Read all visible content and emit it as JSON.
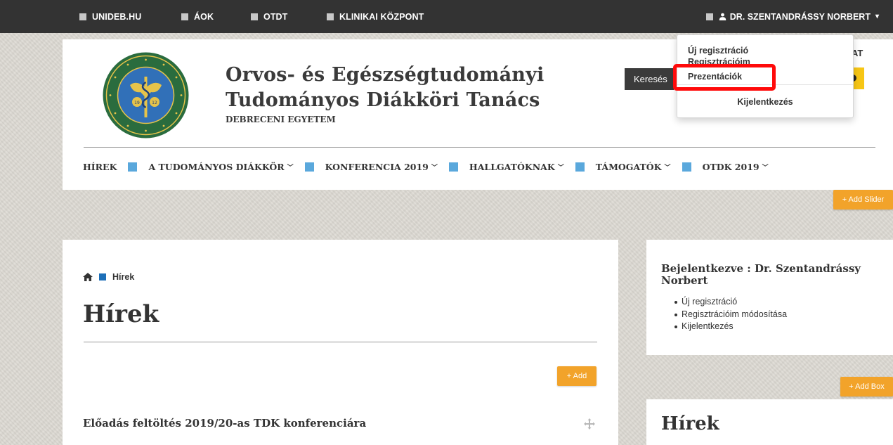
{
  "topbar": {
    "links": [
      "UNIDEB.HU",
      "ÁOK",
      "OTDT",
      "KLINIKAI KÖZPONT"
    ],
    "user_name": "DR. SZENTANDRÁSSY NORBERT",
    "user_icon": "user-icon",
    "caret_icon": "chevron-down-icon"
  },
  "header": {
    "title_line1": "Orvos- és Egészségtudományi",
    "title_line2": "Tudományos Diákköri Tanács",
    "subtitle": "DEBRECENI EGYETEM",
    "logo_text": "UNIVERSITAS DEBRECENIENSIS · FACULTAS SCIENTIARUM MEDICINAE",
    "search_label": "Keresés",
    "lang_peek": "AT"
  },
  "nav": {
    "items": [
      {
        "label": "HÍREK",
        "has_dropdown": false
      },
      {
        "label": "A TUDOMÁNYOS DIÁKKÖR",
        "has_dropdown": true
      },
      {
        "label": "KONFERENCIA 2019",
        "has_dropdown": true
      },
      {
        "label": "HALLGATÓKNAK",
        "has_dropdown": true
      },
      {
        "label": "TÁMOGATÓK",
        "has_dropdown": true
      },
      {
        "label": "OTDK 2019",
        "has_dropdown": true
      }
    ],
    "separator_color": "#5aa8dc"
  },
  "user_dropdown": {
    "items": [
      "Új regisztráció",
      "Regisztrációim",
      "Prezentációk"
    ],
    "logout": "Kijelentkezés",
    "highlighted": "Prezentációk",
    "highlight_color": "#ff0a0a"
  },
  "admin": {
    "add_slider": "+ Add Slider",
    "add": "+ Add",
    "add_box": "+ Add Box",
    "button_color": "#f2a32a"
  },
  "main": {
    "breadcrumb": "Hírek",
    "title": "Hírek",
    "article_title": "Előadás feltöltés 2019/20-as TDK konferenciára"
  },
  "sidebar": {
    "title": "Bejelentkezve : Dr. Szentandrássy Norbert",
    "links": [
      "Új regisztráció",
      "Regisztrációim módosítása",
      "Kijelentkezés"
    ],
    "news_title": "Hírek"
  }
}
